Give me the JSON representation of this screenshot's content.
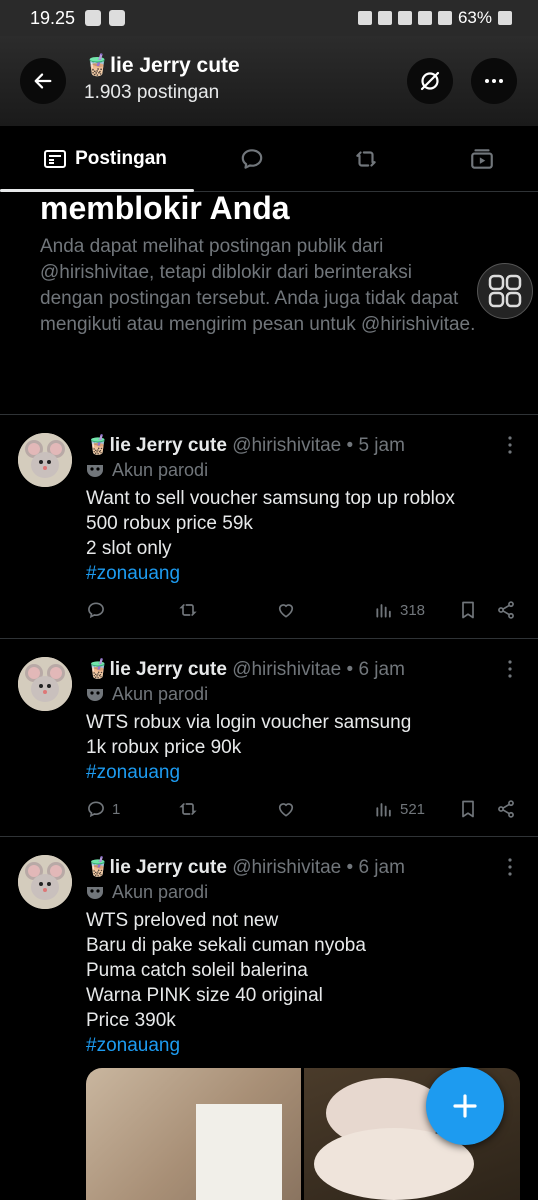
{
  "status_bar": {
    "time": "19.25",
    "battery": "63%"
  },
  "header": {
    "title": "🧋lie Jerry cute",
    "subtitle": "1.903 postingan"
  },
  "tabs": {
    "posts": "Postingan"
  },
  "block_notice": {
    "title": "memblokir Anda",
    "text": "Anda dapat melihat postingan publik dari @hirishivitae, tetapi diblokir dari berinteraksi dengan postingan tersebut. Anda juga tidak dapat mengikuti atau mengirim pesan untuk @hirishivitae."
  },
  "posts": [
    {
      "name": "🧋lie Jerry cute",
      "handle": "@hirishivitae • 5 jam",
      "badge": "Akun parodi",
      "lines": [
        "Want to sell voucher samsung top up roblox",
        "500 robux price 59k",
        "2 slot only"
      ],
      "hashtag": "#zonauang",
      "replies": "",
      "views": "318"
    },
    {
      "name": "🧋lie Jerry cute",
      "handle": "@hirishivitae • 6 jam",
      "badge": "Akun parodi",
      "lines": [
        "WTS robux via login voucher samsung",
        "1k robux price 90k"
      ],
      "hashtag": "#zonauang",
      "replies": "1",
      "views": "521"
    },
    {
      "name": "🧋lie Jerry cute",
      "handle": "@hirishivitae • 6 jam",
      "badge": "Akun parodi",
      "lines": [
        "WTS preloved not new",
        "Baru di pake sekali cuman nyoba",
        "Puma catch soleil balerina",
        "Warna PINK size 40 original",
        "Price 390k"
      ],
      "hashtag": "#zonauang"
    }
  ],
  "colors": {
    "accent": "#1d9bf0",
    "text": "#e7e9ea",
    "muted": "#71767b",
    "background": "#000000"
  }
}
